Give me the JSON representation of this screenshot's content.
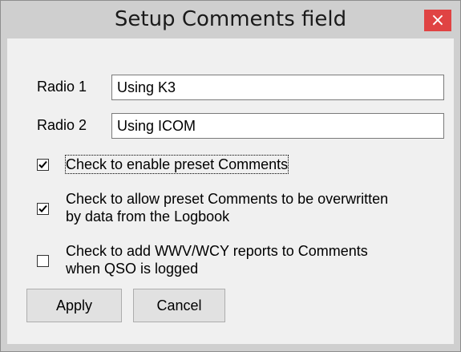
{
  "window": {
    "title": "Setup Comments field",
    "close_icon": "×"
  },
  "fields": [
    {
      "label": "Radio 1",
      "value": "Using K3"
    },
    {
      "label": "Radio 2",
      "value": "Using ICOM"
    }
  ],
  "checks": [
    {
      "label": "Check to enable preset Comments",
      "checked": true
    },
    {
      "label": "Check to allow preset Comments to be overwritten",
      "label2": "by data from the Logbook",
      "checked": true
    },
    {
      "label": "Check to add WWV/WCY reports to Comments",
      "label2": "when QSO is logged",
      "checked": false
    }
  ],
  "buttons": {
    "apply": "Apply",
    "cancel": "Cancel"
  }
}
